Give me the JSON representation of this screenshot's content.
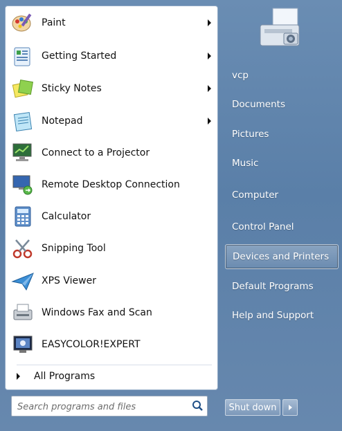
{
  "programs": [
    {
      "label": "Paint",
      "icon": "paint-palette-icon",
      "has_submenu": true
    },
    {
      "label": "Getting Started",
      "icon": "getting-started-icon",
      "has_submenu": true
    },
    {
      "label": "Sticky Notes",
      "icon": "sticky-notes-icon",
      "has_submenu": true
    },
    {
      "label": "Notepad",
      "icon": "notepad-icon",
      "has_submenu": true
    },
    {
      "label": "Connect to a Projector",
      "icon": "projector-icon",
      "has_submenu": false
    },
    {
      "label": "Remote Desktop Connection",
      "icon": "remote-desktop-icon",
      "has_submenu": false
    },
    {
      "label": "Calculator",
      "icon": "calculator-icon",
      "has_submenu": false
    },
    {
      "label": "Snipping Tool",
      "icon": "scissors-icon",
      "has_submenu": false
    },
    {
      "label": "XPS Viewer",
      "icon": "paper-plane-icon",
      "has_submenu": false
    },
    {
      "label": "Windows Fax and Scan",
      "icon": "fax-icon",
      "has_submenu": false
    },
    {
      "label": "EASYCOLOR!EXPERT",
      "icon": "monitor-icon",
      "has_submenu": false
    }
  ],
  "all_programs_label": "All Programs",
  "search": {
    "placeholder": "Search programs and files"
  },
  "right_links": [
    {
      "label": "vcp",
      "highlight": false
    },
    {
      "label": "Documents",
      "highlight": false
    },
    {
      "label": "Pictures",
      "highlight": false
    },
    {
      "label": "Music",
      "highlight": false
    },
    {
      "label": "Computer",
      "highlight": false
    },
    {
      "label": "Control Panel",
      "highlight": false
    },
    {
      "label": "Devices and Printers",
      "highlight": true
    },
    {
      "label": "Default Programs",
      "highlight": false
    },
    {
      "label": "Help and Support",
      "highlight": false
    }
  ],
  "shutdown_label": "Shut down",
  "colors": {
    "menu_bg": "#5f82ab",
    "highlight_border": "#ffffff",
    "text_dark": "#111111"
  }
}
